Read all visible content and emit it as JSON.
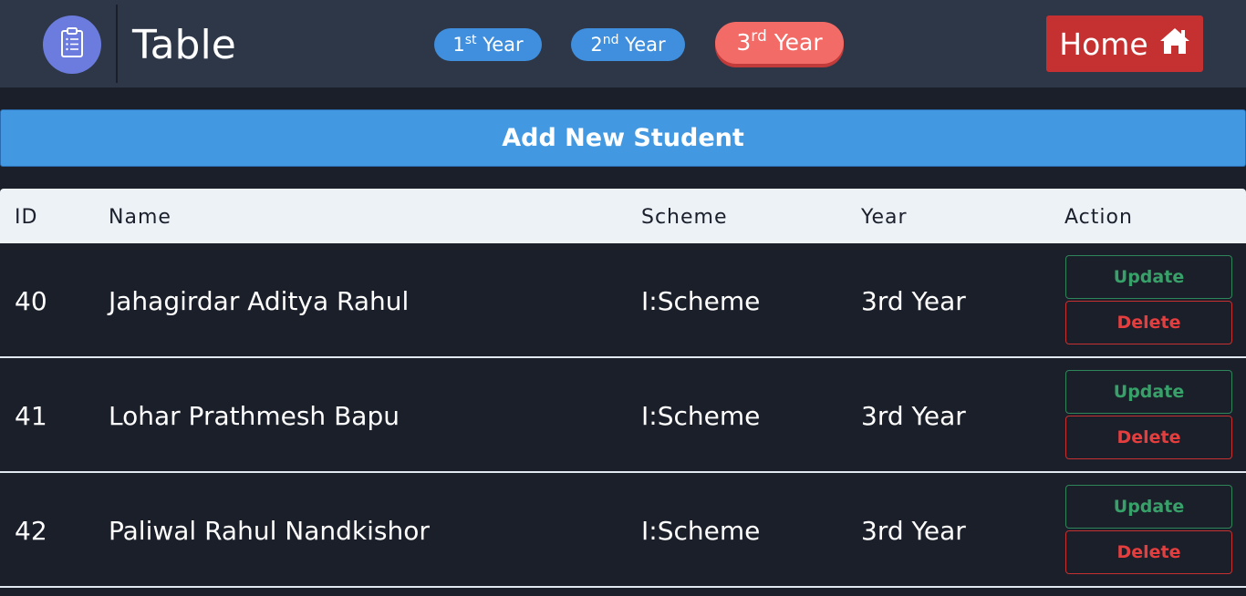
{
  "header": {
    "brand_icon": "clipboard-list-icon",
    "title": "Table",
    "year_tabs": [
      {
        "num": "1",
        "suffix": "st",
        "label": "Year"
      },
      {
        "num": "2",
        "suffix": "nd",
        "label": "Year"
      },
      {
        "num": "3",
        "suffix": "rd",
        "label": "Year",
        "active": true
      }
    ],
    "home_label": "Home",
    "home_icon": "home-icon"
  },
  "add_button_label": "Add New Student",
  "table": {
    "columns": [
      "ID",
      "Name",
      "Scheme",
      "Year",
      "Action"
    ],
    "rows": [
      {
        "id": "40",
        "name": "Jahagirdar Aditya Rahul",
        "scheme": "I:Scheme",
        "year": "3rd Year",
        "update": "Update",
        "delete": "Delete"
      },
      {
        "id": "41",
        "name": "Lohar Prathmesh Bapu",
        "scheme": "I:Scheme",
        "year": "3rd Year",
        "update": "Update",
        "delete": "Delete"
      },
      {
        "id": "42",
        "name": "Paliwal Rahul Nandkishor",
        "scheme": "I:Scheme",
        "year": "3rd Year",
        "update": "Update",
        "delete": "Delete"
      }
    ]
  },
  "colors": {
    "topbar": "#2d3748",
    "background": "#1b1f2a",
    "pill_blue": "#3f8fde",
    "pill_active": "#f26b66",
    "home_red": "#c53030",
    "add_blue": "#4299e1",
    "update_green": "#38a169",
    "delete_red": "#e53e3e"
  }
}
